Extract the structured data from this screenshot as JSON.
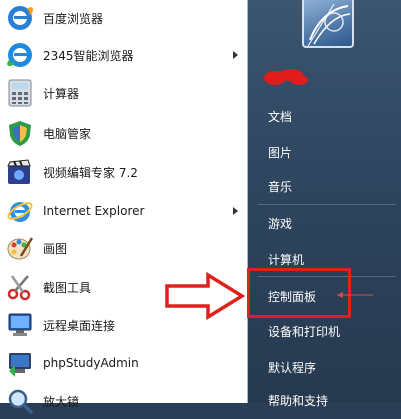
{
  "programs": [
    {
      "label": "百度浏览器",
      "icon": "baidu-browser-icon",
      "has_arrow": false
    },
    {
      "label": "2345智能浏览器",
      "icon": "2345-browser-icon",
      "has_arrow": true
    },
    {
      "label": "计算器",
      "icon": "calculator-icon",
      "has_arrow": false
    },
    {
      "label": "电脑管家",
      "icon": "pc-manager-icon",
      "has_arrow": false
    },
    {
      "label": "视频编辑专家 7.2",
      "icon": "video-editor-icon",
      "has_arrow": false
    },
    {
      "label": "Internet Explorer",
      "icon": "internet-explorer-icon",
      "has_arrow": true
    },
    {
      "label": "画图",
      "icon": "paint-icon",
      "has_arrow": false
    },
    {
      "label": "截图工具",
      "icon": "snipping-tool-icon",
      "has_arrow": false
    },
    {
      "label": "远程桌面连接",
      "icon": "remote-desktop-icon",
      "has_arrow": false
    },
    {
      "label": "phpStudyAdmin",
      "icon": "phpstudy-icon",
      "has_arrow": false
    },
    {
      "label": "放大镜",
      "icon": "magnifier-icon",
      "has_arrow": false
    }
  ],
  "right_menu": {
    "items": [
      {
        "label": "文档"
      },
      {
        "label": "图片"
      },
      {
        "label": "音乐"
      },
      {
        "label": "游戏"
      },
      {
        "label": "计算机"
      },
      {
        "label": "控制面板"
      },
      {
        "label": "设备和打印机"
      },
      {
        "label": "默认程序"
      },
      {
        "label": "帮助和支持"
      }
    ],
    "highlight_color": "#e0201d"
  }
}
